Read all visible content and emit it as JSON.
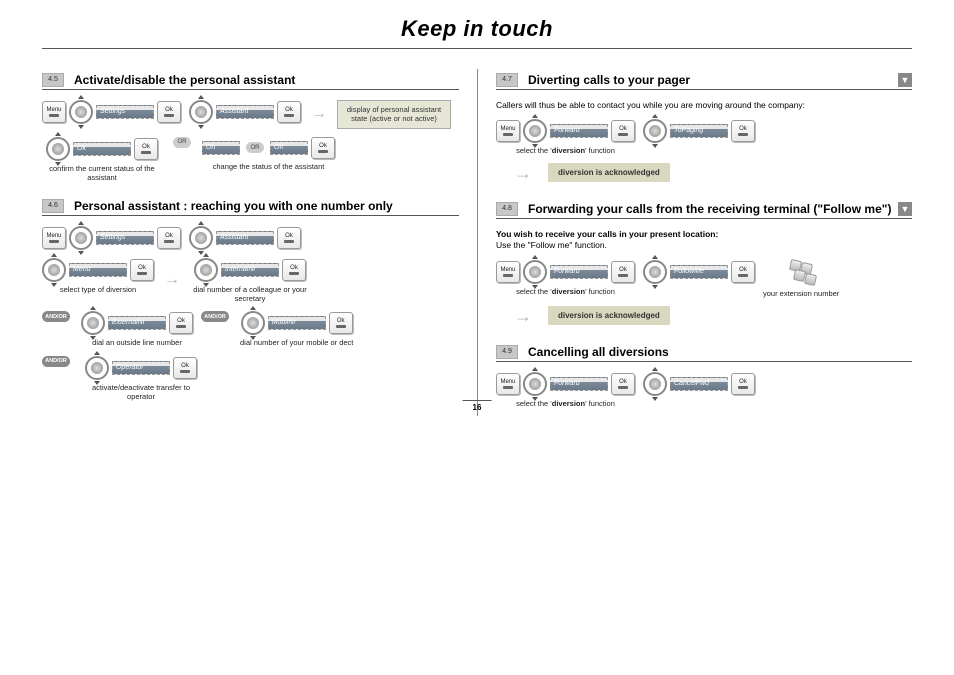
{
  "page_title": "Keep in touch",
  "page_number": "16",
  "labels": {
    "or": "OR",
    "andor": "AND/OR",
    "menu_key": "Menu",
    "ok_key": "Ok"
  },
  "softkeys": {
    "settings": "Settings",
    "assistant": "Assistant",
    "ok": "Ok",
    "on": "On",
    "off": "Off",
    "menu": "Menu",
    "internalnr": "InternalNr",
    "externalnr": "ExternalNr",
    "mobilnr": "MobilNr",
    "operator": "Operator",
    "forward": "Forward",
    "topaging": "ToPaging",
    "followme": "FollowMe",
    "cancelfwd": "CancelFwd"
  },
  "sections": {
    "s45": {
      "num": "4.5",
      "title": "Activate/disable the personal assistant",
      "note_box": "display of personal assistant state (active or not active)",
      "cap_confirm": "confirm the current status of the assistant",
      "cap_change": "change the status of the assistant"
    },
    "s46": {
      "num": "4.6",
      "title": "Personal assistant : reaching you with one number only",
      "cap_type": "select type of diversion",
      "cap_colleague": "dial number of a colleague or your secretary",
      "cap_outside": "dial an outside line number",
      "cap_mobile": "dial number of your mobile  or dect",
      "cap_operator": "activate/deactivate transfer to operator"
    },
    "s47": {
      "num": "4.7",
      "title": "Diverting calls to your pager",
      "intro": "Callers will thus be able to contact you while you are moving around the company:",
      "cap_sel_div": "select the 'diversion' function",
      "ack": "diversion is acknowledged"
    },
    "s48": {
      "num": "4.8",
      "title": "Forwarding your calls from the receiving terminal (\"Follow me\")",
      "intro_bold": "You wish to receive your calls in your present location:",
      "intro_rest": "Use the \"Follow me\" function.",
      "cap_sel_div": "select the 'diversion' function",
      "cap_ext": "your extension number",
      "ack": "diversion is acknowledged"
    },
    "s49": {
      "num": "4.9",
      "title": "Cancelling all diversions",
      "cap_sel_div": "select the 'diversion' function"
    }
  }
}
